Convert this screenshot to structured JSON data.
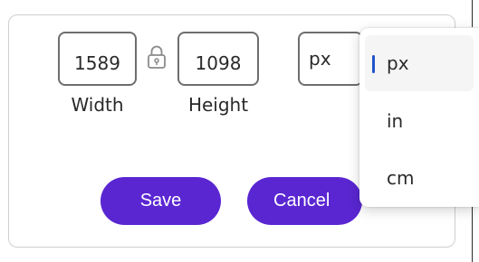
{
  "dimensions": {
    "width_value": "1589",
    "width_label": "Width",
    "height_value": "1098",
    "height_label": "Height",
    "lock_icon": "lock-icon",
    "unit_value": "px"
  },
  "actions": {
    "save_label": "Save",
    "cancel_label": "Cancel"
  },
  "unit_dropdown": {
    "options": [
      {
        "label": "px",
        "selected": true
      },
      {
        "label": "in",
        "selected": false
      },
      {
        "label": "cm",
        "selected": false
      }
    ]
  },
  "colors": {
    "accent": "#5a26d1",
    "selection_indicator": "#2054c8",
    "field_border": "#6e6e6e"
  }
}
